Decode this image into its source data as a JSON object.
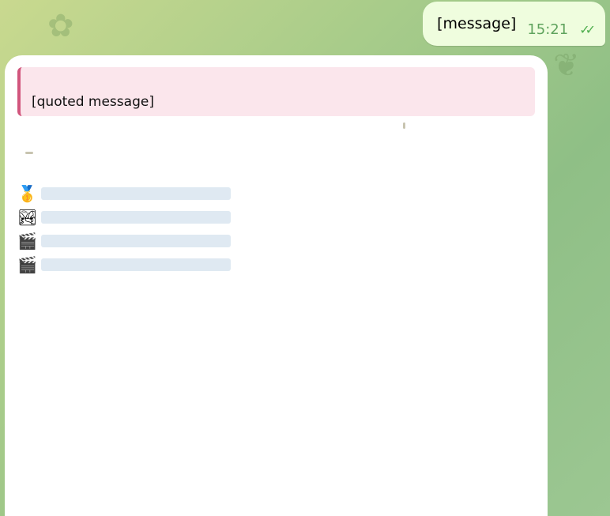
{
  "outgoing": {
    "text": "[message]",
    "time": "15:21",
    "status_icon": "double-check-icon"
  },
  "incoming": {
    "reply_quote": "[quoted message]",
    "results": [
      {
        "icon": "medal-icon"
      },
      {
        "icon": "landscape-icon"
      },
      {
        "icon": "clapperboard-icon"
      },
      {
        "icon": "clapperboard-icon"
      }
    ]
  },
  "colors": {
    "out_bubble": "#effdde",
    "reply_bar": "#d1557c",
    "link": "#1a73c2"
  }
}
